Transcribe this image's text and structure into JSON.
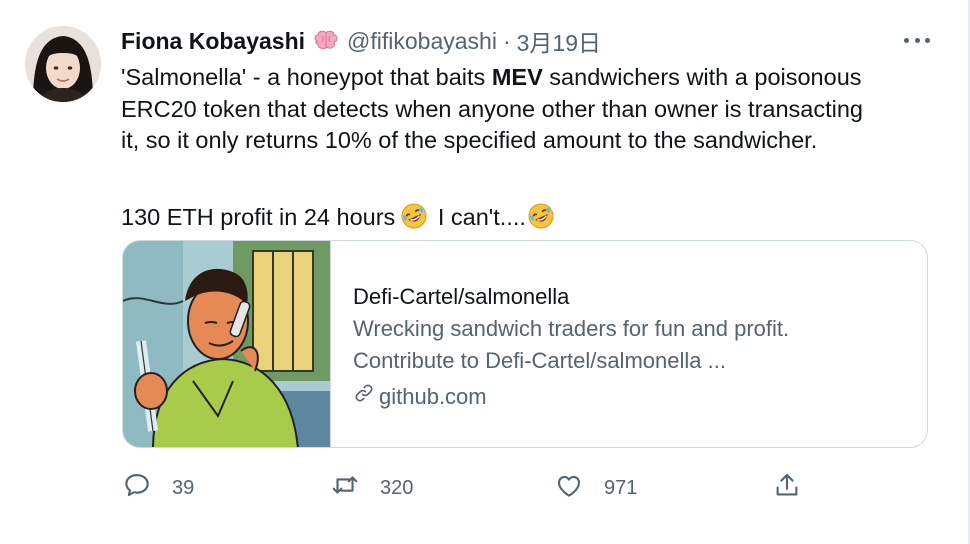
{
  "tweet": {
    "author": {
      "display_name": "Fiona Kobayashi",
      "badge_icon": "brain-emoji",
      "handle": "@fifikobayashi",
      "separator": "·",
      "date": "3月19日"
    },
    "more_icon": "more-horizontal-icon",
    "text": {
      "line1_pre": "'Salmonella' - a honeypot that baits ",
      "line1_bold": "MEV",
      "line1_post": " sandwichers with a poisonous",
      "line2": "ERC20 token that detects when anyone other than owner is transacting",
      "line3": "it, so it only returns 10% of the specified amount to the sandwicher.",
      "line4_pre": "130 ETH profit in 24 hours",
      "line4_mid": " I can't....",
      "emoji_icon": "rolling-on-floor-laughing-emoji"
    },
    "card": {
      "title": "Defi-Cartel/salmonella",
      "description_line1": "Wrecking sandwich traders for fun and profit.",
      "description_line2": "Contribute to Defi-Cartel/salmonella ...",
      "domain": "github.com",
      "link_icon": "link-icon"
    },
    "actions": {
      "reply_count": "39",
      "retweet_count": "320",
      "like_count": "971",
      "reply_icon": "reply-icon",
      "retweet_icon": "retweet-icon",
      "like_icon": "heart-icon",
      "share_icon": "share-icon"
    },
    "colors": {
      "text_primary": "#0f1419",
      "text_secondary": "#536471",
      "border": "#cfd9de"
    }
  }
}
